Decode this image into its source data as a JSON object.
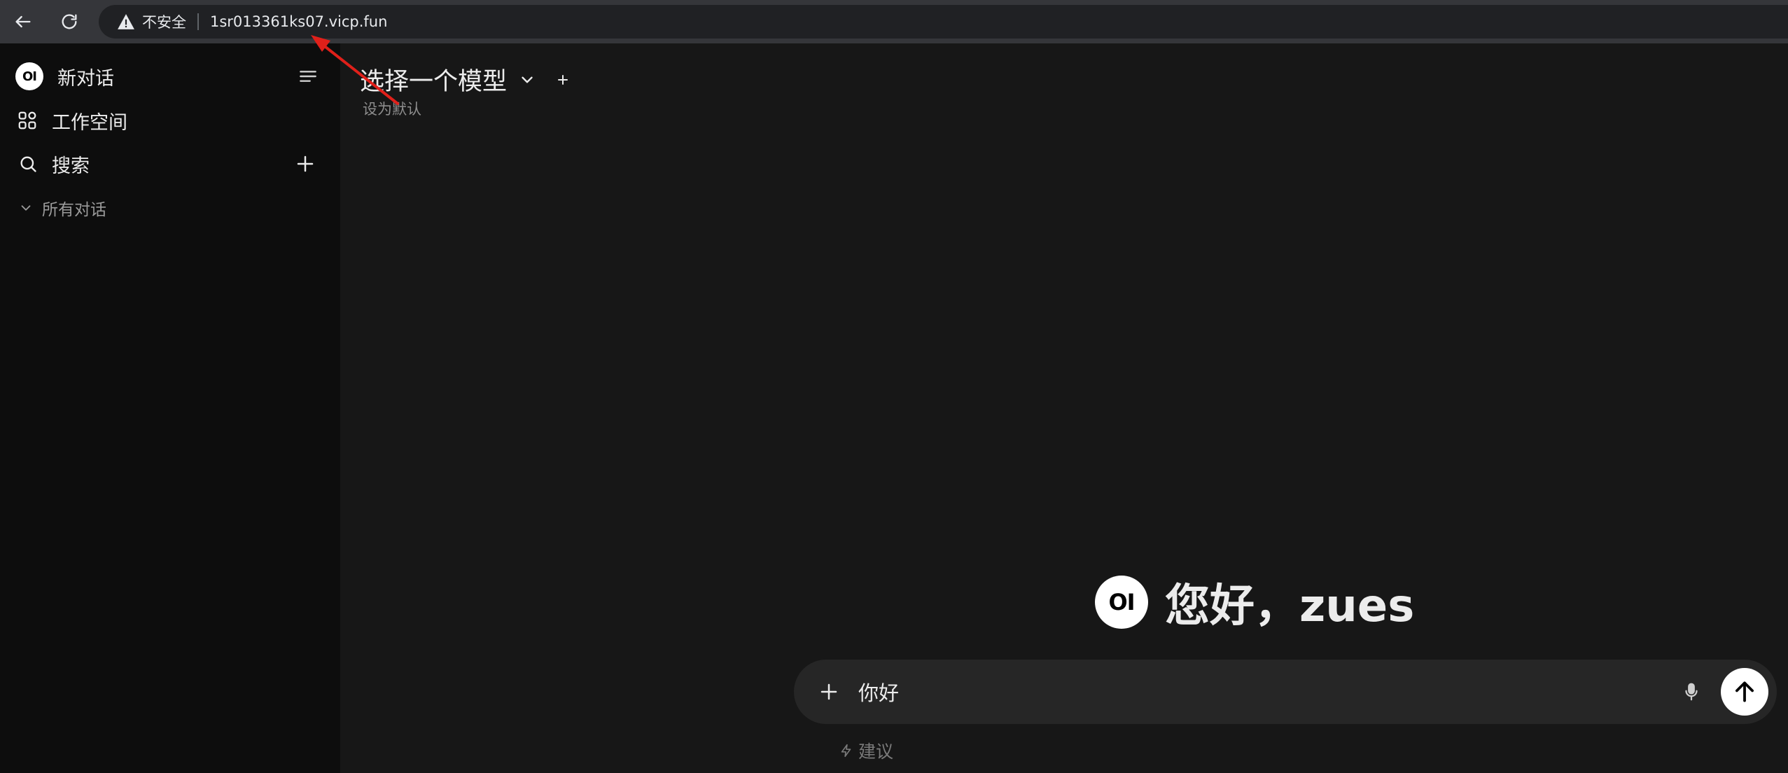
{
  "browser": {
    "security_label": "不安全",
    "url": "1sr013361ks07.vicp.fun"
  },
  "sidebar": {
    "logo_text": "OI",
    "new_chat_label": "新对话",
    "workspace_label": "工作空间",
    "search_label": "搜索",
    "all_chats_label": "所有对话"
  },
  "main": {
    "model_selector_label": "选择一个模型",
    "set_default_label": "设为默认",
    "greeting_logo_text": "OI",
    "greeting_text": "您好，zues",
    "composer_value": "你好",
    "suggestion_label": "建议"
  },
  "colors": {
    "sidebar_bg": "#0d0d0d",
    "main_bg": "#171717",
    "composer_bg": "#262626",
    "annotation_arrow": "#e0201a"
  }
}
